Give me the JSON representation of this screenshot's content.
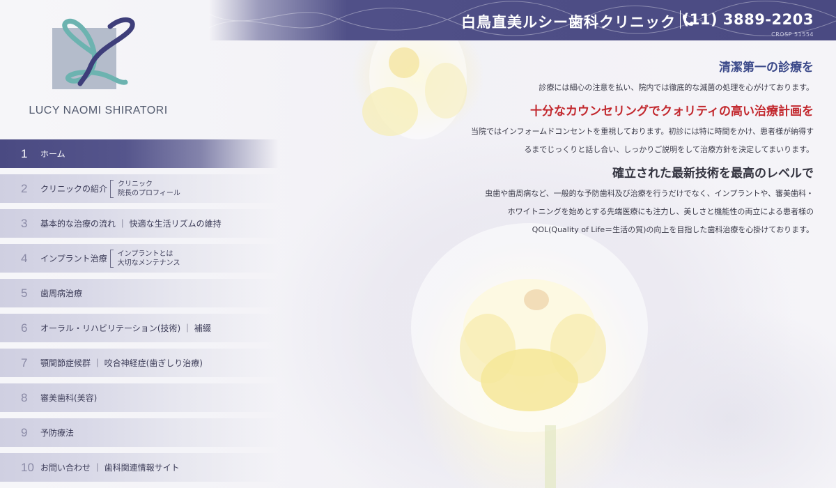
{
  "header": {
    "clinic_name": "白鳥直美ルシー歯科クリニック",
    "phone": "(11) 3889-2203",
    "registration": "CROSP 51554"
  },
  "logo": {
    "text": "LUCY NAOMI SHIRATORI"
  },
  "nav": {
    "items": [
      {
        "num": "1",
        "label": "ホーム",
        "sub": []
      },
      {
        "num": "2",
        "label": "クリニックの紹介",
        "sub": [
          "クリニック",
          "院長のプロフィール"
        ]
      },
      {
        "num": "3",
        "label": "基本的な治療の流れ ｜ 快適な生活リズムの維持",
        "sub": []
      },
      {
        "num": "4",
        "label": "インプラント治療",
        "sub": [
          "インプラントとは",
          "大切なメンテナンス"
        ]
      },
      {
        "num": "5",
        "label": "歯周病治療",
        "sub": []
      },
      {
        "num": "6",
        "label": "オーラル・リハビリテーション(技術) ｜ 補綴",
        "sub": []
      },
      {
        "num": "7",
        "label": "顎関節症候群 ｜ 咬合神経症(歯ぎしり治療)",
        "sub": []
      },
      {
        "num": "8",
        "label": "審美歯科(美容)",
        "sub": []
      },
      {
        "num": "9",
        "label": "予防療法",
        "sub": []
      },
      {
        "num": "10",
        "label": "お問い合わせ ｜ 歯科関連情報サイト",
        "sub": []
      }
    ],
    "active_index": 0
  },
  "content": {
    "sections": [
      {
        "heading": "清潔第一の診療を",
        "lines": [
          "診療には細心の注意を払い、院内では徹底的な滅菌の処理を心がけております。"
        ]
      },
      {
        "heading": "十分なカウンセリングでクォリティの高い治療計画を",
        "lines": [
          "当院ではインフォームドコンセントを重視しております。初診には特に時間をかけ、患者様が納得す",
          "るまでじっくりと話し合い、しっかりご説明をして治療方針を決定してまいります。"
        ]
      },
      {
        "heading": "確立された最新技術を最高のレベルで",
        "lines": [
          "虫歯や歯周病など、一般的な予防歯科及び治療を行うだけでなく、インプラントや、審美歯科・",
          "ホワイトニングを始めとする先端医療にも注力し、美しさと機能性の両立による患者様の",
          "QOL(Quality of Life＝生活の質)の向上を目指した歯科治療を心掛けております。"
        ]
      }
    ]
  },
  "colors": {
    "nav_active": "#4a4a82",
    "heading_blue": "#3c4a8a",
    "heading_red": "#c2272d",
    "heading_dark": "#33333f",
    "logo_square": "#b4bccb",
    "logo_teal": "#6cb3b0",
    "logo_purple": "#3e3e7a"
  },
  "icons": {
    "phone": "phone-icon",
    "logo": "logo-l-mark"
  }
}
